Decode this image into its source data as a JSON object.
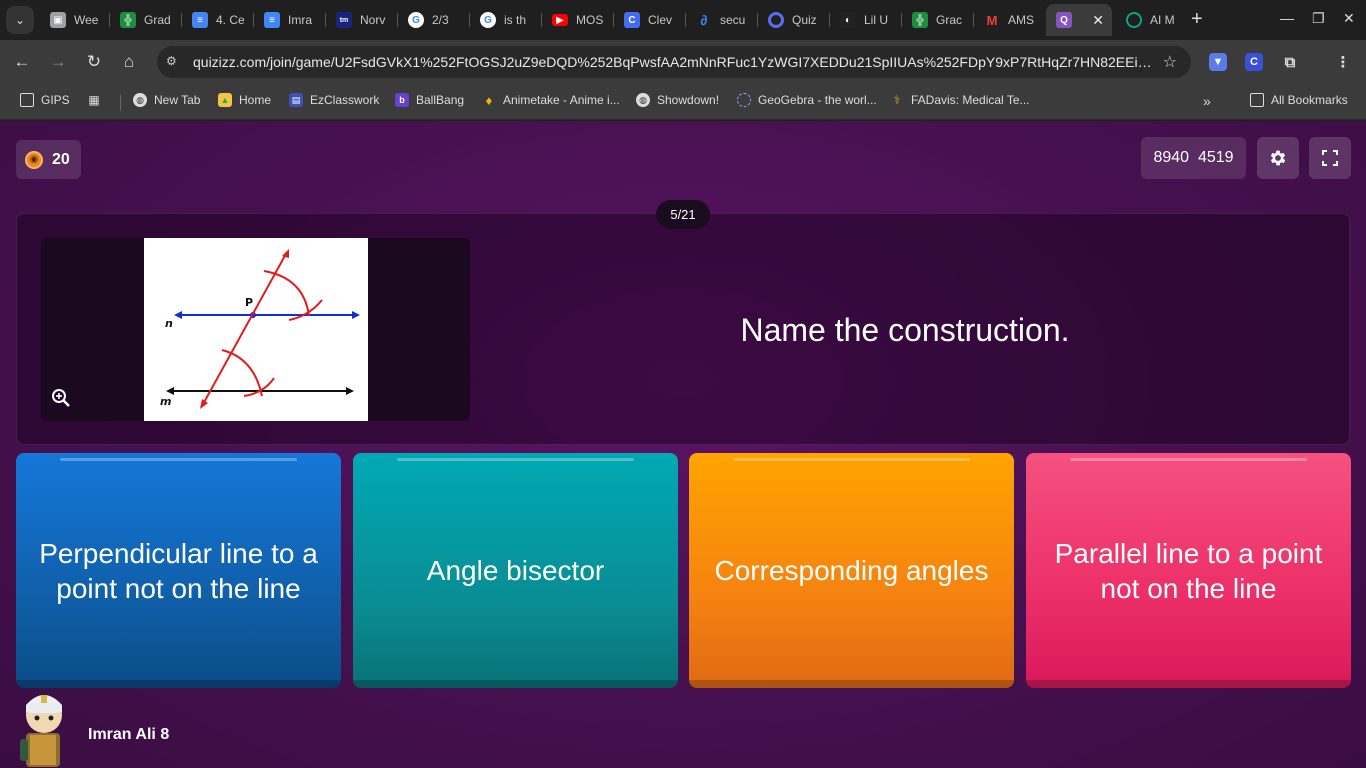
{
  "browser": {
    "tabs": [
      {
        "title": "Wee",
        "icon": "classroom-icon",
        "color": "#9aa0a6"
      },
      {
        "title": "Grad",
        "icon": "sheets-icon",
        "color": "#1e8e3e"
      },
      {
        "title": "4. Ce",
        "icon": "docs-icon",
        "color": "#4285f4"
      },
      {
        "title": "Imra",
        "icon": "docs-icon",
        "color": "#4285f4"
      },
      {
        "title": "Norv",
        "icon": "norvelle-icon",
        "color": "#1a237e"
      },
      {
        "title": "2/3",
        "icon": "google-icon",
        "color": "#ffffff"
      },
      {
        "title": "is th",
        "icon": "google-icon",
        "color": "#ffffff"
      },
      {
        "title": "MOS",
        "icon": "youtube-icon",
        "color": "#ff0000"
      },
      {
        "title": "Clev",
        "icon": "clever-icon",
        "color": "#436cf2"
      },
      {
        "title": "secu",
        "icon": "link-icon",
        "color": "#4285f4"
      },
      {
        "title": "Quiz",
        "icon": "quizizz-icon",
        "color": "#5b6cf0"
      },
      {
        "title": "Lil U",
        "icon": "music-icon",
        "color": "#222222"
      },
      {
        "title": "Grac",
        "icon": "sheets-icon",
        "color": "#1e8e3e"
      },
      {
        "title": "AMS",
        "icon": "gmail-icon",
        "color": "#ea4335"
      },
      {
        "title": "",
        "icon": "quizizz-icon",
        "color": "#8854c0",
        "active": true
      },
      {
        "title": "AI M",
        "icon": "ai-icon",
        "color": "#10a37f"
      }
    ],
    "url": "quizizz.com/join/game/U2FsdGVkX1%252FtOGSJ2uZ9eDQD%252BqPwsfAA2mNnRFuc1YzWGI7XEDDu21SpIIUAs%252FDpY9xP7RtHqZr7HN82EEiBE...",
    "bookmarks": [
      {
        "label": "GIPS",
        "icon": "folder-icon"
      },
      {
        "label": "New Tab",
        "icon": "globe-icon"
      },
      {
        "label": "Home",
        "icon": "home-bookmark-icon"
      },
      {
        "label": "EzClasswork",
        "icon": "ezclasswork-icon"
      },
      {
        "label": "BallBang",
        "icon": "ballbang-icon"
      },
      {
        "label": "Animetake - Anime i...",
        "icon": "flame-icon"
      },
      {
        "label": "Showdown!",
        "icon": "globe-icon"
      },
      {
        "label": "GeoGebra - the worl...",
        "icon": "geogebra-icon"
      },
      {
        "label": "FADavis: Medical Te...",
        "icon": "fadavis-icon"
      }
    ],
    "all_bookmarks": "All Bookmarks"
  },
  "quiz": {
    "streak": "20",
    "score_left": "8940",
    "score_right": "4519",
    "counter": "5/21",
    "question": "Name the construction.",
    "figure": {
      "label_p": "P",
      "label_n": "n",
      "label_m": "m"
    },
    "options": [
      "Perpendicular line to a point not on the line",
      "Angle bisector",
      "Corresponding angles",
      "Parallel line to a point not on the line"
    ],
    "player_name": "Imran Ali 8",
    "colors": {
      "option1": "#1265c2",
      "option2": "#0a9aa3",
      "option3": "#f58310",
      "option4": "#ec2f68",
      "background": "#4b1053"
    }
  }
}
